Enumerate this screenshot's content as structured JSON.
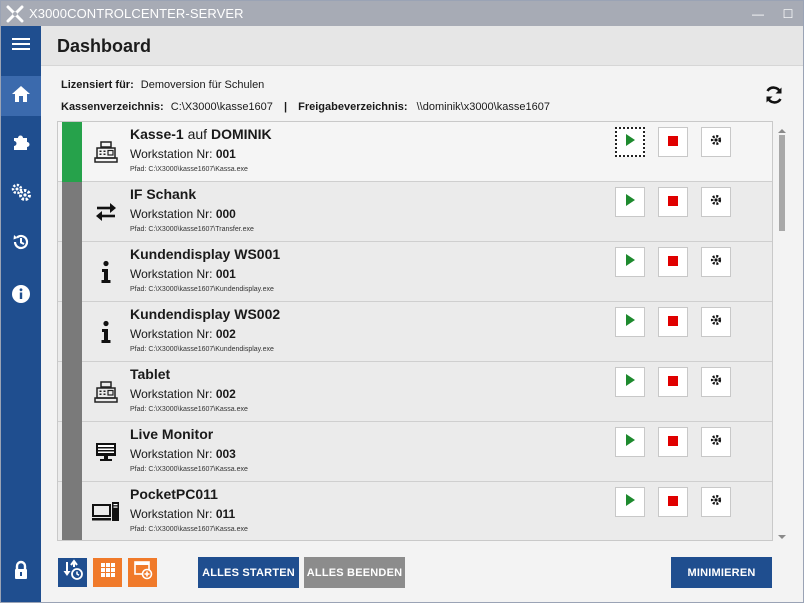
{
  "window": {
    "title": "X3000CONTROLCENTER-SERVER",
    "minimize_glyph": "—",
    "maximize_glyph": "☐"
  },
  "sidebar": {
    "items": [
      {
        "icon": "hamburger-icon"
      },
      {
        "icon": "home-icon",
        "active": true
      },
      {
        "icon": "puzzle-icon"
      },
      {
        "icon": "gears-icon"
      },
      {
        "icon": "history-icon"
      },
      {
        "icon": "info-icon"
      },
      {
        "icon": "lock-icon"
      }
    ]
  },
  "header": {
    "title": "Dashboard"
  },
  "info": {
    "licensed_label": "Lizensiert für:",
    "licensed_value": "Demoversion für Schulen",
    "cash_dir_label": "Kassenverzeichnis:",
    "cash_dir_value": "C:\\X3000\\kasse1607",
    "separator": "|",
    "share_dir_label": "Freigabeverzeichnis:",
    "share_dir_value": "\\\\dominik\\x3000\\kasse1607"
  },
  "workstations": [
    {
      "name": "Kasse-1",
      "name_suffix_plain": " auf ",
      "name_suffix_bold": "DOMINIK",
      "ws_label": "Workstation Nr:",
      "ws_number": "001",
      "path_label": "Pfad:",
      "path": "C:\\X3000\\kasse1607\\Kassa.exe",
      "icon": "cash-register-icon",
      "status": "running",
      "focused_play": true
    },
    {
      "name": "IF Schank",
      "name_suffix_plain": "",
      "name_suffix_bold": "",
      "ws_label": "Workstation Nr:",
      "ws_number": "000",
      "path_label": "Pfad:",
      "path": "C:\\X3000\\kasse1607\\Transfer.exe",
      "icon": "transfer-arrows-icon",
      "status": "stopped"
    },
    {
      "name": "Kundendisplay WS001",
      "name_suffix_plain": "",
      "name_suffix_bold": "",
      "ws_label": "Workstation Nr:",
      "ws_number": "001",
      "path_label": "Pfad:",
      "path": "C:\\X3000\\kasse1607\\Kundendisplay.exe",
      "icon": "info-letter-icon",
      "status": "stopped"
    },
    {
      "name": "Kundendisplay WS002",
      "name_suffix_plain": "",
      "name_suffix_bold": "",
      "ws_label": "Workstation Nr:",
      "ws_number": "002",
      "path_label": "Pfad:",
      "path": "C:\\X3000\\kasse1607\\Kundendisplay.exe",
      "icon": "info-letter-icon",
      "status": "stopped"
    },
    {
      "name": "Tablet",
      "name_suffix_plain": "",
      "name_suffix_bold": "",
      "ws_label": "Workstation Nr:",
      "ws_number": "002",
      "path_label": "Pfad:",
      "path": "C:\\X3000\\kasse1607\\Kassa.exe",
      "icon": "cash-register-icon",
      "status": "stopped"
    },
    {
      "name": "Live Monitor",
      "name_suffix_plain": "",
      "name_suffix_bold": "",
      "ws_label": "Workstation Nr:",
      "ws_number": "003",
      "path_label": "Pfad:",
      "path": "C:\\X3000\\kasse1607\\Kassa.exe",
      "icon": "monitor-icon",
      "status": "stopped"
    },
    {
      "name": "PocketPC011",
      "name_suffix_plain": "",
      "name_suffix_bold": "",
      "ws_label": "Workstation Nr:",
      "ws_number": "011",
      "path_label": "Pfad:",
      "path": "C:\\X3000\\kasse1607\\Kassa.exe",
      "icon": "desktop-pc-icon",
      "status": "stopped"
    }
  ],
  "footer": {
    "start_all_label": "ALLES STARTEN",
    "stop_all_label": "ALLES BEENDEN",
    "minimize_label": "MINIMIEREN",
    "tool_icons": [
      "sort-clock-icon",
      "grid-apps-icon",
      "add-window-icon"
    ]
  },
  "colors": {
    "sidebar": "#1f4e8f",
    "running": "#26a24b",
    "stopped": "#7a7a7a",
    "play": "#1e8a2e",
    "stop": "#e00000",
    "orange": "#f07a2a"
  }
}
